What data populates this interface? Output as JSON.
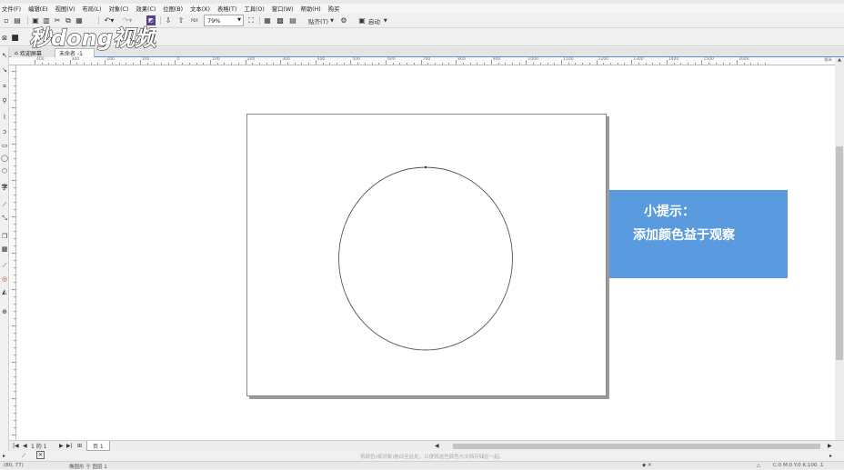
{
  "menu": [
    "文件(F)",
    "编辑(E)",
    "视图(V)",
    "布局(L)",
    "对象(C)",
    "效果(C)",
    "位图(B)",
    "文本(X)",
    "表格(T)",
    "工具(O)",
    "窗口(W)",
    "帮助(H)",
    "购买"
  ],
  "toolbar": {
    "zoom_value": "79%",
    "snap_label": "贴齐(T)",
    "launch_label": "启动",
    "pdf_label": "PDF"
  },
  "logo": {
    "text": "秒dong视频"
  },
  "doc_tabs": {
    "welcome": "欢迎屏幕",
    "untitled": "未命名 -1"
  },
  "ruler": {
    "labels": [
      "400",
      "300",
      "200",
      "100",
      "0",
      "100",
      "200",
      "300",
      "400",
      "500",
      "600",
      "700",
      "800",
      "900",
      "1000",
      "1100",
      "1200",
      "1300",
      "1400",
      "1500",
      "1600"
    ],
    "unit": "毫米"
  },
  "tip": {
    "title": "小提示：",
    "body": "添加颜色益于观察"
  },
  "pagebar": {
    "page_count": "1 的 1",
    "page_tab": "页 1"
  },
  "status": {
    "hint": "将颜色(或对象)拖动至此处，以便将这些颜色与文档存储在一起。",
    "left_text": "(80, 77)",
    "mid_text": "椭圆形 于 图层 1",
    "right_text": "C:0 M:0 Y:0 K:100 .1"
  }
}
